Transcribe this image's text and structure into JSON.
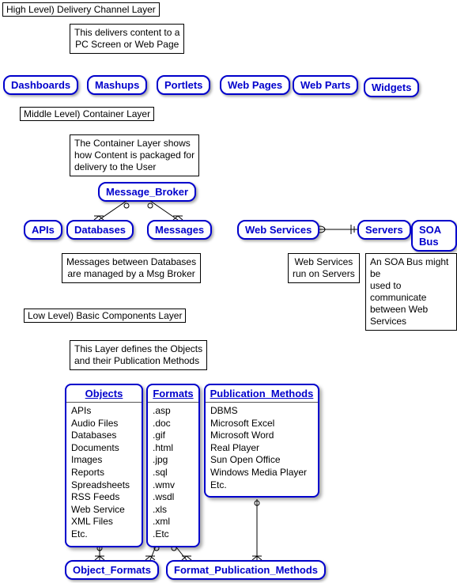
{
  "high_level": {
    "title": "High Level)  Delivery Channel Layer",
    "desc": "This delivers content to a\nPC Screen or Web Page",
    "nodes": {
      "dashboards": "Dashboards",
      "mashups": "Mashups",
      "portlets": "Portlets",
      "webpages": "Web Pages",
      "webparts": "Web Parts",
      "widgets": "Widgets"
    }
  },
  "middle_level": {
    "title": "Middle Level)  Container Layer",
    "desc": "The Container Layer shows\nhow Content is packaged for\ndelivery to the User",
    "nodes": {
      "message_broker": "Message_Broker",
      "apis": "APIs",
      "databases": "Databases",
      "messages": "Messages",
      "web_services": "Web Services",
      "servers": "Servers",
      "soa_bus": "SOA Bus"
    },
    "notes": {
      "msg_broker": "Messages between Databases\nare managed by a Msg Broker",
      "ws_servers": "Web Services\nrun on Servers",
      "soa_comm": "An SOA Bus might be\nused to communicate\nbetween Web Services"
    }
  },
  "low_level": {
    "title": "Low Level) Basic Components Layer",
    "desc": "This Layer defines the Objects\nand their Publication Methods",
    "entities": {
      "objects": {
        "title": "Objects",
        "items": [
          "APIs",
          "Audio Files",
          "Databases",
          "Documents",
          "Images",
          "Reports",
          "Spreadsheets",
          "RSS Feeds",
          "Web Service",
          "XML Files",
          "Etc."
        ]
      },
      "formats": {
        "title": "Formats",
        "items": [
          ".asp",
          ".doc",
          ".gif",
          ".html",
          ".jpg",
          ".sql",
          ".wmv",
          ".wsdl",
          ".xls",
          ".xml",
          ".Etc"
        ]
      },
      "publication_methods": {
        "title": "Publication_Methods",
        "items": [
          "DBMS",
          "Microsoft Excel",
          "Microsoft Word",
          "Real Player",
          "Sun Open Office",
          "Windows Media Player",
          "Etc."
        ]
      },
      "object_formats": "Object_Formats",
      "format_publication_methods": "Format_Publication_Methods"
    }
  },
  "chart_data": {
    "type": "diagram",
    "title": "Layered Architecture Diagram",
    "layers": [
      {
        "name": "High Level) Delivery Channel Layer",
        "description": "This delivers content to a PC Screen or Web Page",
        "components": [
          "Dashboards",
          "Mashups",
          "Portlets",
          "Web Pages",
          "Web Parts",
          "Widgets"
        ]
      },
      {
        "name": "Middle Level) Container Layer",
        "description": "The Container Layer shows how Content is packaged for delivery to the User",
        "components": [
          "APIs",
          "Databases",
          "Messages",
          "Message_Broker",
          "Web Services",
          "Servers",
          "SOA Bus"
        ],
        "relationships": [
          {
            "from": "Message_Broker",
            "to": "Databases",
            "type": "one-to-many"
          },
          {
            "from": "Message_Broker",
            "to": "Messages",
            "type": "one-to-many"
          },
          {
            "from": "Web Services",
            "to": "Servers",
            "type": "many-to-one"
          },
          {
            "note": "Messages between Databases are managed by a Msg Broker"
          },
          {
            "note": "Web Services run on Servers"
          },
          {
            "note": "An SOA Bus might be used to communicate between Web Services"
          }
        ]
      },
      {
        "name": "Low Level) Basic Components Layer",
        "description": "This Layer defines the Objects and their Publication Methods",
        "entities": [
          {
            "name": "Objects",
            "attributes": [
              "APIs",
              "Audio Files",
              "Databases",
              "Documents",
              "Images",
              "Reports",
              "Spreadsheets",
              "RSS Feeds",
              "Web Service",
              "XML Files",
              "Etc."
            ]
          },
          {
            "name": "Formats",
            "attributes": [
              ".asp",
              ".doc",
              ".gif",
              ".html",
              ".jpg",
              ".sql",
              ".wmv",
              ".wsdl",
              ".xls",
              ".xml",
              ".Etc"
            ]
          },
          {
            "name": "Publication_Methods",
            "attributes": [
              "DBMS",
              "Microsoft Excel",
              "Microsoft Word",
              "Real Player",
              "Sun Open Office",
              "Windows Media Player",
              "Etc."
            ]
          },
          {
            "name": "Object_Formats"
          },
          {
            "name": "Format_Publication_Methods"
          }
        ],
        "relationships": [
          {
            "from": "Objects",
            "to": "Object_Formats",
            "type": "one-to-many"
          },
          {
            "from": "Formats",
            "to": "Object_Formats",
            "type": "one-to-many"
          },
          {
            "from": "Formats",
            "to": "Format_Publication_Methods",
            "type": "one-to-many"
          },
          {
            "from": "Publication_Methods",
            "to": "Format_Publication_Methods",
            "type": "one-to-many"
          }
        ]
      }
    ]
  }
}
